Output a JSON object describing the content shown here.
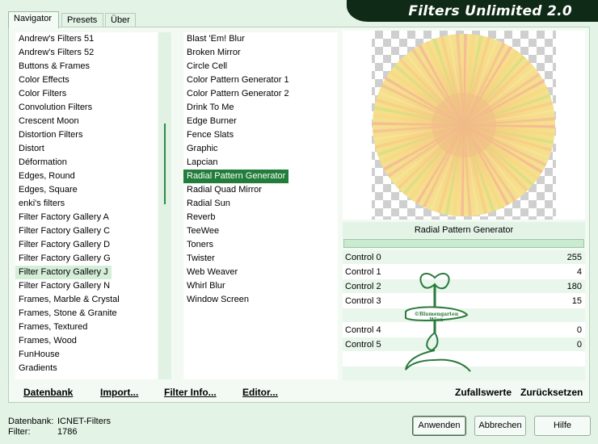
{
  "window": {
    "title": "Filters Unlimited 2.0"
  },
  "tabs": [
    {
      "label": "Navigator"
    },
    {
      "label": "Presets"
    },
    {
      "label": "Über"
    }
  ],
  "categories": [
    "Andrew's Filters 51",
    "Andrew's Filters 52",
    "Buttons & Frames",
    "Color Effects",
    "Color Filters",
    "Convolution Filters",
    "Crescent Moon",
    "Distortion Filters",
    "Distort",
    "Déformation",
    "Edges, Round",
    "Edges, Square",
    "enki's filters",
    "Filter Factory Gallery A",
    "Filter Factory Gallery C",
    "Filter Factory Gallery D",
    "Filter Factory Gallery G",
    "Filter Factory Gallery J",
    "Filter Factory Gallery N",
    "Frames, Marble & Crystal",
    "Frames, Stone & Granite",
    "Frames, Textured",
    "Frames, Wood",
    "FunHouse",
    "Gradients"
  ],
  "selected_category": "Filter Factory Gallery J",
  "filters": [
    "Blast 'Em! Blur",
    "Broken Mirror",
    "Circle Cell",
    "Color Pattern Generator 1",
    "Color Pattern Generator 2",
    "Drink To Me",
    "Edge Burner",
    "Fence Slats",
    "Graphic",
    "Lapcian",
    "Radial Pattern Generator",
    "Radial Quad Mirror",
    "Radial Sun",
    "Reverb",
    "TeeWee",
    "Toners",
    "Twister",
    "Web Weaver",
    "Whirl Blur",
    "Window Screen"
  ],
  "selected_filter": "Radial Pattern Generator",
  "preview": {
    "filter_name": "Radial Pattern Generator"
  },
  "controls": [
    {
      "label": "Control 0",
      "value": "255"
    },
    {
      "label": "Control 1",
      "value": "4"
    },
    {
      "label": "Control 2",
      "value": "180"
    },
    {
      "label": "Control 3",
      "value": "15"
    },
    {
      "label": "Control 4",
      "value": "0"
    },
    {
      "label": "Control 5",
      "value": "0"
    }
  ],
  "watermark": {
    "text": "©Blumengarten Wien"
  },
  "toolbar": {
    "datenbank": "Datenbank",
    "import": "Import...",
    "filter_info": "Filter Info...",
    "editor": "Editor...",
    "zufallswerte": "Zufallswerte",
    "zuruecksetzen": "Zurücksetzen"
  },
  "info": {
    "datenbank_label": "Datenbank:",
    "datenbank_value": "ICNET-Filters",
    "filter_label": "Filter:",
    "filter_value": "1786"
  },
  "buttons": {
    "apply": "Anwenden",
    "cancel": "Abbrechen",
    "help": "Hilfe"
  },
  "colors": {
    "accent": "#227d3a",
    "title_bg": "#0f2a16",
    "panel_bg": "#e3f3e6"
  }
}
